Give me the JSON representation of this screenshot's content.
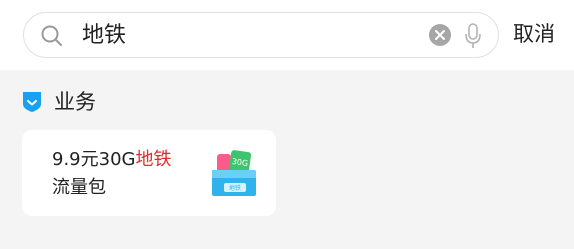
{
  "search": {
    "query": "地铁",
    "cancel_label": "取消"
  },
  "section": {
    "title": "业务"
  },
  "card": {
    "line1_prefix": "9.9元30G",
    "line1_highlight": "地铁",
    "line2": "流量包",
    "art_badge": "30G",
    "art_label": "地铁"
  },
  "colors": {
    "accent": "#1aa0f0",
    "highlight": "#e22b2b"
  }
}
